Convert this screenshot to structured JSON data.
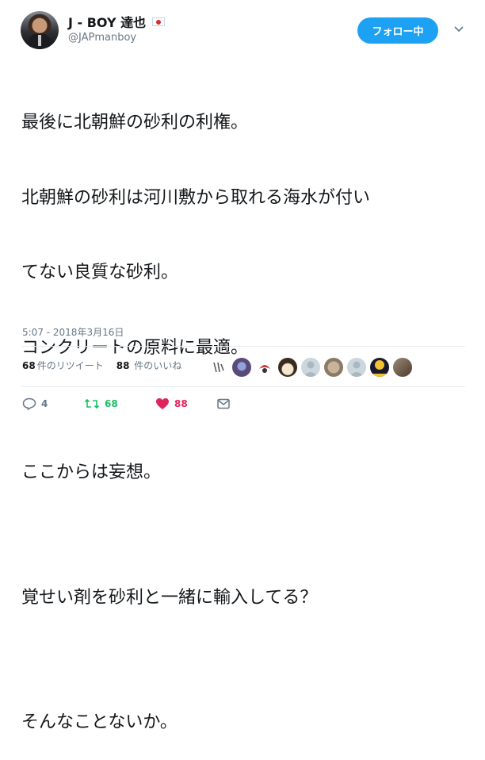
{
  "user": {
    "display_name": "J - BOY 達也",
    "handle": "@JAPmanboy",
    "flag_icon": "japan-flag-icon"
  },
  "follow_button": {
    "label": "フォロー中",
    "color": "#1da1f2"
  },
  "tweet": {
    "lines": [
      "最後に北朝鮮の砂利の利権。",
      "北朝鮮の砂利は河川敷から取れる海水が付い",
      "てない良質な砂利。",
      "コンクリートの原料に最適。",
      "",
      "ここからは妄想。",
      "",
      "覚せい剤を砂利と一緒に輸入してる？",
      "",
      "そんなことないか。"
    ],
    "timestamp": "5:07 - 2018年3月16日"
  },
  "stats": {
    "retweets_count": "68",
    "retweets_label": "件のリツイート",
    "likes_count": "88",
    "likes_label": " 件のいいね"
  },
  "likers": [
    {
      "icon": "liker-avatar-1",
      "color": "#ffffff"
    },
    {
      "icon": "liker-avatar-2",
      "color": "#5a4a7a"
    },
    {
      "icon": "liker-avatar-3",
      "color": "#ffffff"
    },
    {
      "icon": "liker-avatar-4",
      "color": "#3d2a1e"
    },
    {
      "icon": "liker-avatar-5",
      "color": "#aab8c2"
    },
    {
      "icon": "liker-avatar-6",
      "color": "#8a7a66"
    },
    {
      "icon": "liker-avatar-7",
      "color": "#aab8c2"
    },
    {
      "icon": "liker-avatar-8",
      "color": "#1a1a2e"
    },
    {
      "icon": "liker-avatar-9",
      "color": "#6b5a4a"
    }
  ],
  "actions": {
    "reply_count": "4",
    "retweet_count": "68",
    "like_count": "88",
    "reply_color": "#657786",
    "retweet_color": "#17bf63",
    "like_color": "#e0245e"
  }
}
